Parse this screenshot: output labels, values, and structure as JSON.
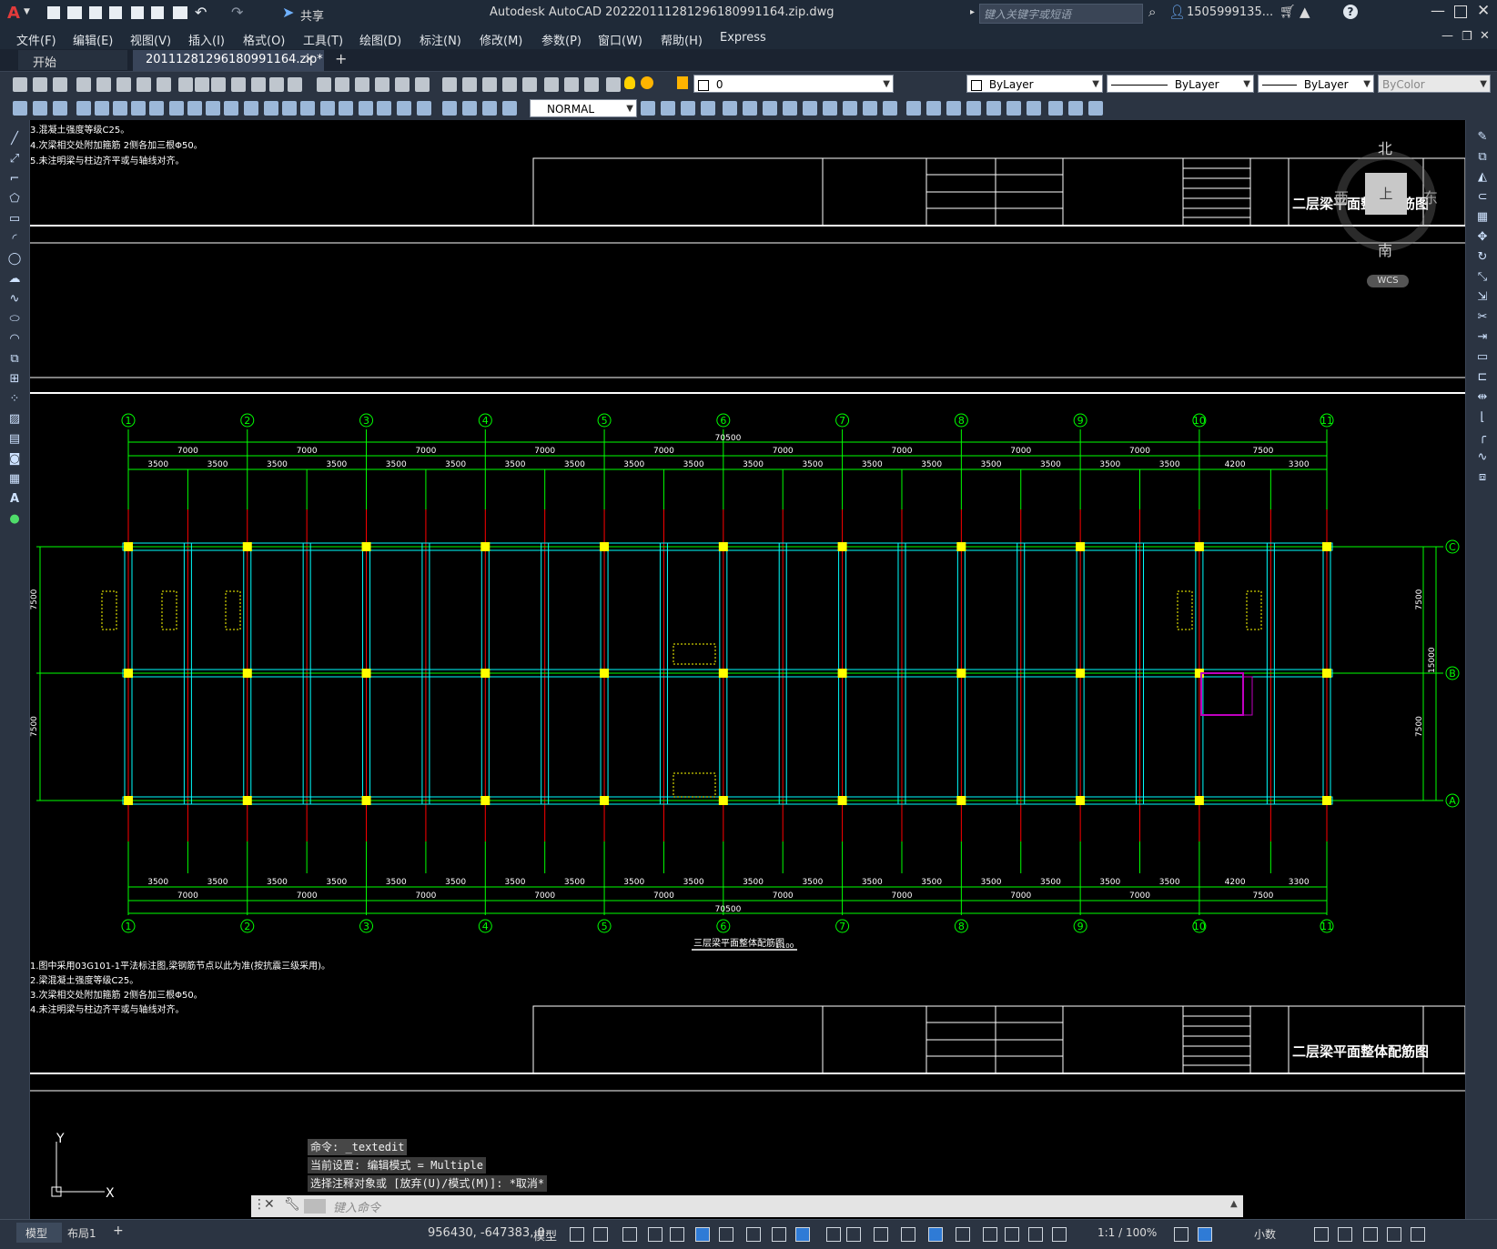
{
  "window": {
    "app_title": "Autodesk AutoCAD 2022",
    "file_title": "20111281296180991164.zip.dwg",
    "search_placeholder": "键入关键字或短语",
    "user": "1505999135...",
    "share_label": "共享"
  },
  "menu": [
    "文件(F)",
    "编辑(E)",
    "视图(V)",
    "插入(I)",
    "格式(O)",
    "工具(T)",
    "绘图(D)",
    "标注(N)",
    "修改(M)",
    "参数(P)",
    "窗口(W)",
    "帮助(H)",
    "Express"
  ],
  "tabs": {
    "start": "开始",
    "active": "20111281296180991164.zip*",
    "close": "×",
    "add": "+"
  },
  "toolbar": {
    "layer_value": "0",
    "color_value": "ByLayer",
    "linetype_value": "ByLayer",
    "lineweight_value": "ByLayer",
    "plotstyle_value": "ByColor",
    "text_style": "NORMAL"
  },
  "viewcube": {
    "north": "北",
    "south": "南",
    "east": "东",
    "west": "西",
    "top": "上",
    "wcs": "WCS"
  },
  "drawing": {
    "notes_top": [
      "3.混凝土强度等级C25。",
      "4.次梁相交处附加箍筋 2侧各加三根Φ50。",
      "5.未注明梁与柱边齐平或与轴线对齐。"
    ],
    "notes_bottom": [
      "1.图中采用03G101-1平法标注图,梁钢筋节点以此为准(按抗震三级采用)。",
      "2.梁混凝土强度等级C25。",
      "3.次梁相交处附加箍筋 2侧各加三根Φ50。",
      "4.未注明梁与柱边齐平或与轴线对齐。"
    ],
    "titleblock_sheet_title": "二层梁平面整体配筋图",
    "drawing_caption": "三层梁平面整体配筋图",
    "caption_scale": "1:100",
    "axis_labels": [
      "1",
      "2",
      "3",
      "4",
      "5",
      "6",
      "7",
      "8",
      "9",
      "10",
      "11"
    ],
    "row_labels": [
      "C",
      "B",
      "A"
    ],
    "total_dim": "70500",
    "spans_7000": [
      "7000",
      "7000",
      "7000",
      "7000",
      "7000",
      "7000",
      "7000",
      "7000",
      "7000",
      "7500"
    ],
    "spans_half": [
      "3500",
      "3500",
      "3500",
      "3500",
      "3500",
      "3500",
      "3500",
      "3500",
      "3500",
      "3500",
      "3500",
      "3500",
      "3500",
      "3500",
      "3500",
      "3500",
      "3500",
      "3500",
      "4200",
      "3300"
    ],
    "side_dims_left": [
      "7500",
      "7500"
    ],
    "side_dims_right": [
      "7500",
      "15000",
      "7500"
    ]
  },
  "command": {
    "history": [
      "命令: _textedit",
      "当前设置: 编辑模式 = Multiple",
      "选择注释对象或 [放弃(U)/模式(M)]: *取消*"
    ],
    "placeholder": "键入命令"
  },
  "status": {
    "tab_model": "模型",
    "tab_layout": "布局1",
    "coords": "956430, -647383, 0",
    "model_label": "模型",
    "scale": "1:1 / 100%",
    "units": "小数"
  },
  "colors": {
    "axis_green": "#00ff00",
    "beam_cyan": "#00ffff",
    "column_yellow": "#ffff00",
    "grid_red": "#ff0000",
    "annotation_yellow": "#ffff00"
  }
}
